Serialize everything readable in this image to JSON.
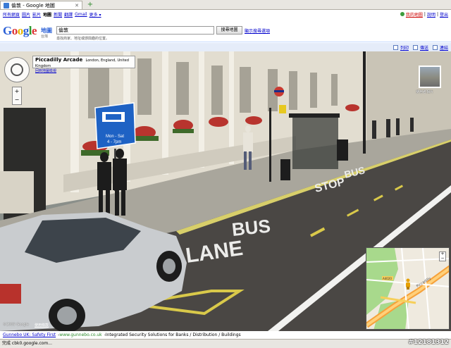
{
  "browser": {
    "tab_title": "倫敦 - Google 地圖",
    "new_tab": "+"
  },
  "gnav": {
    "items": [
      "所有網頁",
      "圖片",
      "影片",
      "地圖",
      "新聞",
      "翻譯",
      "Gmail",
      "更多 ▾"
    ],
    "current_index": 3,
    "right": {
      "links": [
        "我的地圖",
        "說明",
        "登出"
      ]
    }
  },
  "header": {
    "product": "地圖",
    "product_sub": "台灣",
    "search_value": "倫敦",
    "search_button": "搜尋地圖",
    "search_options": "顯示搜尋選項",
    "hint": "尋找商家、地址或感興趣的位置。"
  },
  "toolbar": {
    "links": [
      "列印",
      "傳送",
      "連結"
    ]
  },
  "streetview": {
    "place_name": "Piccadilly Arcade",
    "place_city": "London, England, United Kingdom",
    "place_sub": "回到地圖檢視",
    "thumb_label": "使用者相片",
    "copyright": "©2009 Google",
    "terms": "使用條款",
    "bus_lane_text": [
      "BUS",
      "LANE"
    ],
    "bus_stop_text": [
      "BUS",
      "STOP"
    ],
    "sign_text": [
      "Mon - Sat",
      "4 - 7pm"
    ]
  },
  "minimap": {
    "zoom_plus": "+",
    "zoom_minus": "−",
    "road_label": "Piccadilly",
    "route_badge": "A4020"
  },
  "ad": {
    "title": "Gunnebo UK: Safety First",
    "url": "www.gunnebo.co.uk",
    "text": "Integrated Security Solutions for Banks / Distribution / Buildings"
  },
  "status": "完成 cbk0.google.com...",
  "watermark": "#12181312",
  "colors": {
    "toolbar_bg": "#e5ecf9",
    "route": "#f6a13a",
    "park": "#a8d98c"
  }
}
